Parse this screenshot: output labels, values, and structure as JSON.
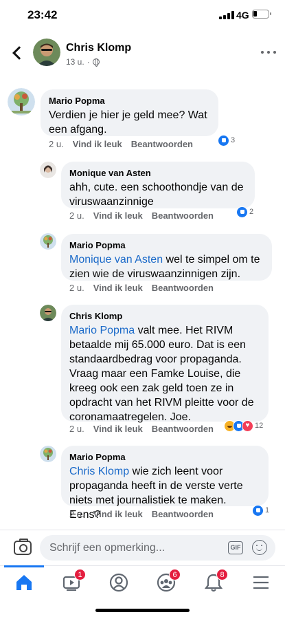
{
  "status": {
    "time": "23:42",
    "network": "4G"
  },
  "header": {
    "name": "Chris Klomp",
    "meta": "13 u."
  },
  "comments": [
    {
      "author": "Mario Popma",
      "text": "Verdien je hier je geld mee? Wat een afgang.",
      "time": "2 u.",
      "like": "Vind ik leuk",
      "reply": "Beantwoorden",
      "reactions": "3"
    },
    {
      "author": "Monique van Asten",
      "text": "ahh, cute. een schoothondje van de viruswaanzinnige",
      "time": "2 u.",
      "like": "Vind ik leuk",
      "reply": "Beantwoorden",
      "reactions": "2"
    },
    {
      "author": "Mario Popma",
      "mention": "Monique van Asten",
      "text": " wel te simpel om te zien wie de viruswaanzinnigen zijn.",
      "time": "2 u.",
      "like": "Vind ik leuk",
      "reply": "Beantwoorden"
    },
    {
      "author": "Chris Klomp",
      "mention": "Mario Popma",
      "text": " valt mee. Het RIVM betaalde mij 65.000 euro. Dat is een standaardbedrag voor propaganda. Vraag maar een Famke Louise, die kreeg ook een zak geld toen ze in opdracht van het RIVM  pleitte voor de coronamaatregelen. Joe.",
      "time": "2 u.",
      "like": "Vind ik leuk",
      "reply": "Beantwoorden",
      "reactions": "12"
    },
    {
      "author": "Mario Popma",
      "mention": "Chris Klomp",
      "text": " wie zich leent voor propaganda heeft in de verste verte niets met journalistiek te maken. Eens?",
      "time": "2 u.",
      "like": "Vind ik leuk",
      "reply": "Beantwoorden",
      "reactions": "1"
    }
  ],
  "composer": {
    "placeholder": "Schrijf een opmerking...",
    "gif": "GIF"
  },
  "tabs": {
    "watch_badge": "1",
    "groups_badge": "6",
    "notifications_badge": "8"
  },
  "colors": {
    "accent": "#1877f2",
    "mention": "#1b6ac9",
    "badge": "#e41e3f",
    "bubble": "#f0f2f5"
  },
  "icons": [
    "back-icon",
    "globe-icon",
    "more-icon",
    "camera-icon",
    "gif-icon",
    "emoji-icon",
    "home-icon",
    "watch-icon",
    "profile-icon",
    "groups-icon",
    "bell-icon",
    "menu-icon"
  ]
}
